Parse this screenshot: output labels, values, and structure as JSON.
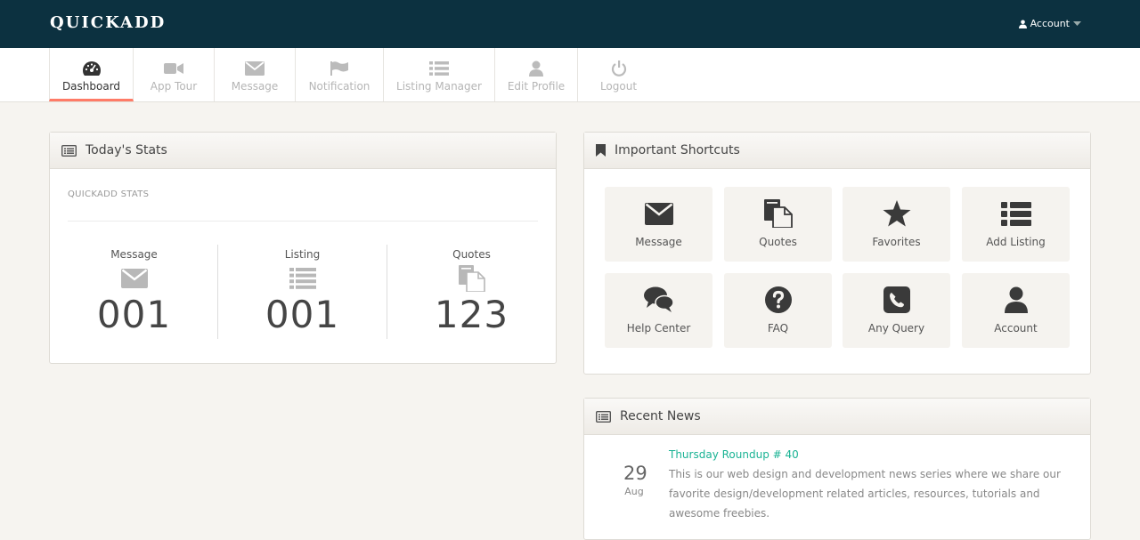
{
  "header": {
    "brand": "QUICKADD",
    "account_label": "Account"
  },
  "nav": [
    {
      "label": "Dashboard",
      "icon": "dashboard-icon",
      "active": true
    },
    {
      "label": "App Tour",
      "icon": "video-camera-icon"
    },
    {
      "label": "Message",
      "icon": "envelope-icon"
    },
    {
      "label": "Notification",
      "icon": "flag-icon"
    },
    {
      "label": "Listing Manager",
      "icon": "list-icon"
    },
    {
      "label": "Edit Profile",
      "icon": "user-icon"
    },
    {
      "label": "Logout",
      "icon": "power-icon"
    }
  ],
  "stats_panel": {
    "title": "Today's Stats",
    "subtitle": "QUICKADD STATS",
    "items": [
      {
        "label": "Message",
        "value": "001",
        "icon": "envelope-icon"
      },
      {
        "label": "Listing",
        "value": "001",
        "icon": "list-icon"
      },
      {
        "label": "Quotes",
        "value": "123",
        "icon": "files-icon"
      }
    ]
  },
  "shortcuts_panel": {
    "title": "Important Shortcuts",
    "items": [
      {
        "label": "Message",
        "icon": "envelope-icon"
      },
      {
        "label": "Quotes",
        "icon": "files-icon"
      },
      {
        "label": "Favorites",
        "icon": "star-icon"
      },
      {
        "label": "Add Listing",
        "icon": "list-icon"
      },
      {
        "label": "Help Center",
        "icon": "comments-icon"
      },
      {
        "label": "FAQ",
        "icon": "question-icon"
      },
      {
        "label": "Any Query",
        "icon": "phone-icon"
      },
      {
        "label": "Account",
        "icon": "user-icon"
      }
    ]
  },
  "news_panel": {
    "title": "Recent News",
    "items": [
      {
        "day": "29",
        "month": "Aug",
        "title": "Thursday Roundup # 40",
        "text": "This is our web design and development news series where we share our favorite design/development related articles, resources, tutorials and awesome freebies."
      }
    ]
  },
  "colors": {
    "topbar": "#0c3140",
    "page_bg": "#f6f4f0",
    "active_tab_underline": "#ff7b67",
    "news_title": "#1ab394"
  }
}
